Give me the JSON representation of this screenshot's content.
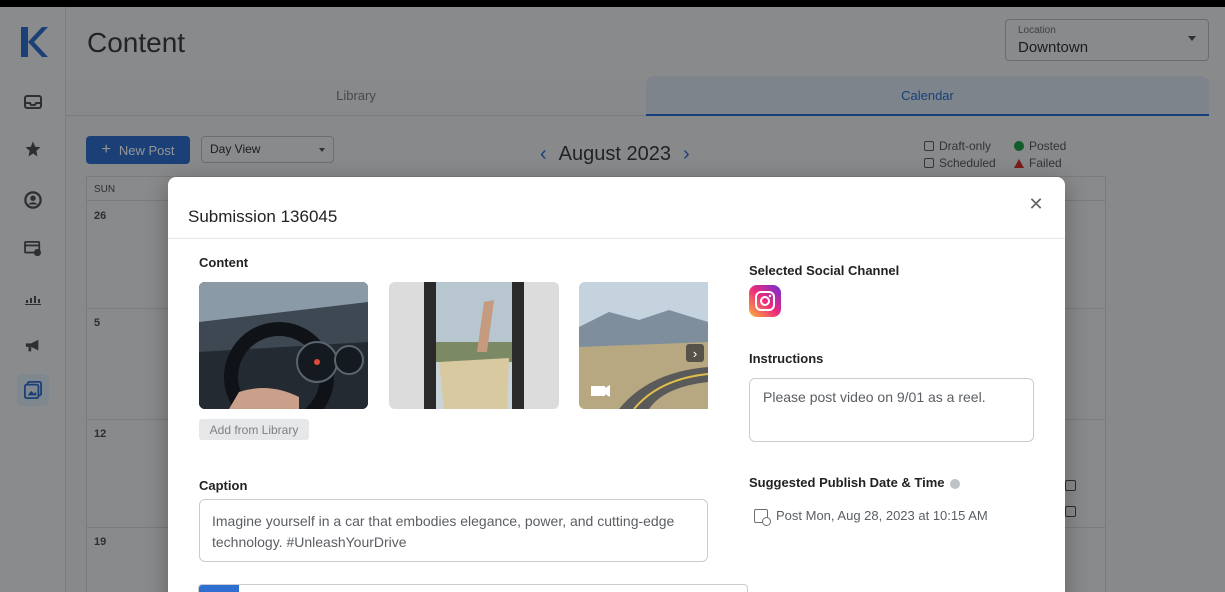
{
  "app": {
    "logo_letter": "K",
    "page_title": "Content"
  },
  "location": {
    "label": "Location",
    "value": "Downtown"
  },
  "tabs": [
    {
      "label": "Library"
    },
    {
      "label": "Calendar"
    }
  ],
  "toolbar": {
    "new_post_label": "New Post",
    "view_select_value": "Day View",
    "month_label": "August 2023"
  },
  "legend": {
    "draft": "Draft-only",
    "scheduled": "Scheduled",
    "posted": "Posted",
    "failed": "Failed"
  },
  "calendar": {
    "day_header": "SUN",
    "dates": [
      "26",
      "5",
      "12",
      "19"
    ]
  },
  "modal": {
    "title": "Submission 136045",
    "content_label": "Content",
    "add_library_label": "Add from Library",
    "caption_label": "Caption",
    "caption_text": "Imagine yourself in a car that embodies elegance, power, and cutting-edge technology. #UnleashYourDrive",
    "selected_channel_label": "Selected Social Channel",
    "instructions_label": "Instructions",
    "instructions_placeholder": "Please post video on 9/01 as a reel.",
    "suggested_label": "Suggested Publish Date & Time",
    "post_date": "Post Mon, Aug 28, 2023 at 10:15 AM"
  },
  "colors": {
    "accent": "#2f6fcf",
    "posted": "#1f9d4b",
    "failed": "#d1342c"
  }
}
